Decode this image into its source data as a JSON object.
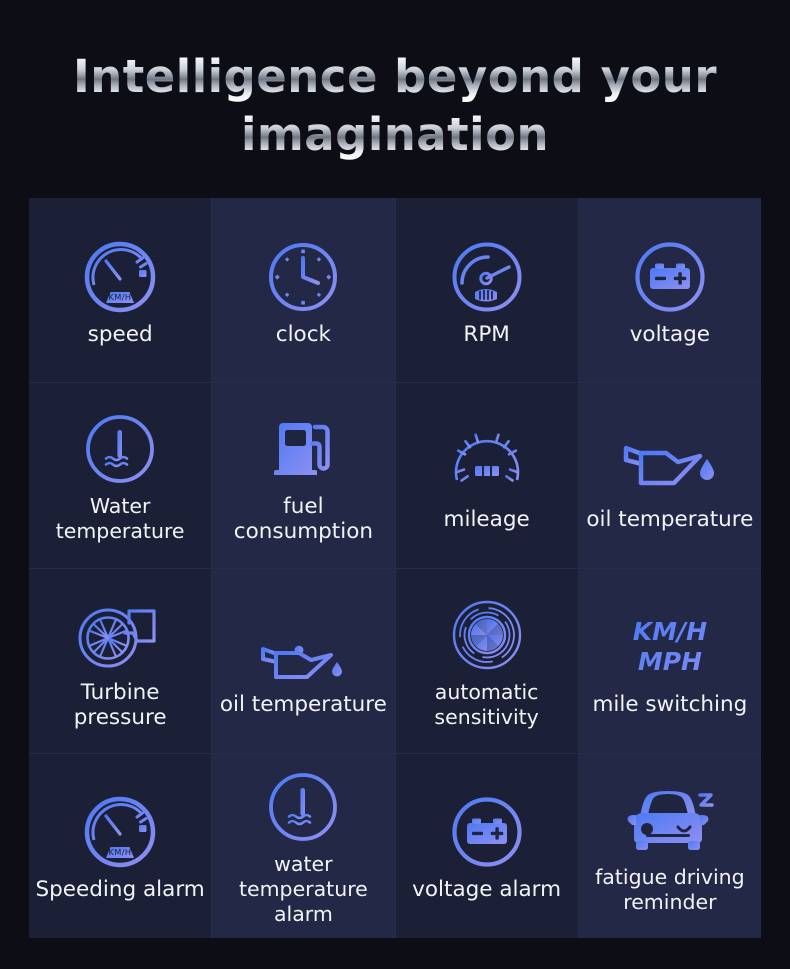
{
  "title": {
    "line1": "Intelligence beyond your",
    "line2": "imagination"
  },
  "theme": {
    "page_background": "#0d0d16",
    "cell_dark": "#1c2036",
    "cell_light": "#232847",
    "grid_line": "#272c4a",
    "icon_gradient_start": "#4d79f3",
    "icon_gradient_end": "#8e90f2",
    "label_color": "#f2f3f7",
    "unit_text_color": "#5a7af0"
  },
  "features": [
    {
      "label": "speed",
      "icon": "speedometer-icon",
      "badge": "KM/H"
    },
    {
      "label": "clock",
      "icon": "clock-icon"
    },
    {
      "label": "RPM",
      "icon": "tachometer-icon"
    },
    {
      "label": "voltage",
      "icon": "battery-circle-icon"
    },
    {
      "label": "Water\ntemperature",
      "icon": "water-temperature-icon"
    },
    {
      "label": "fuel\nconsumption",
      "icon": "fuel-pump-icon"
    },
    {
      "label": "mileage",
      "icon": "odometer-icon"
    },
    {
      "label": "oil temperature",
      "icon": "oil-can-icon"
    },
    {
      "label": "Turbine\npressure",
      "icon": "turbocharger-icon"
    },
    {
      "label": "oil temperature",
      "icon": "oil-can-thermometer-icon"
    },
    {
      "label": "automatic\nsensitivity",
      "icon": "aperture-sensor-icon"
    },
    {
      "label": "mile switching",
      "icon": "unit-text",
      "unit_line1": "KM/H",
      "unit_line2": "MPH"
    },
    {
      "label": "Speeding alarm",
      "icon": "speedometer-icon",
      "badge": "KM/H"
    },
    {
      "label": "water\ntemperature\nalarm",
      "icon": "water-temperature-icon"
    },
    {
      "label": "voltage alarm",
      "icon": "battery-circle-icon"
    },
    {
      "label": "fatigue driving\nreminder",
      "icon": "sleepy-car-icon"
    }
  ]
}
